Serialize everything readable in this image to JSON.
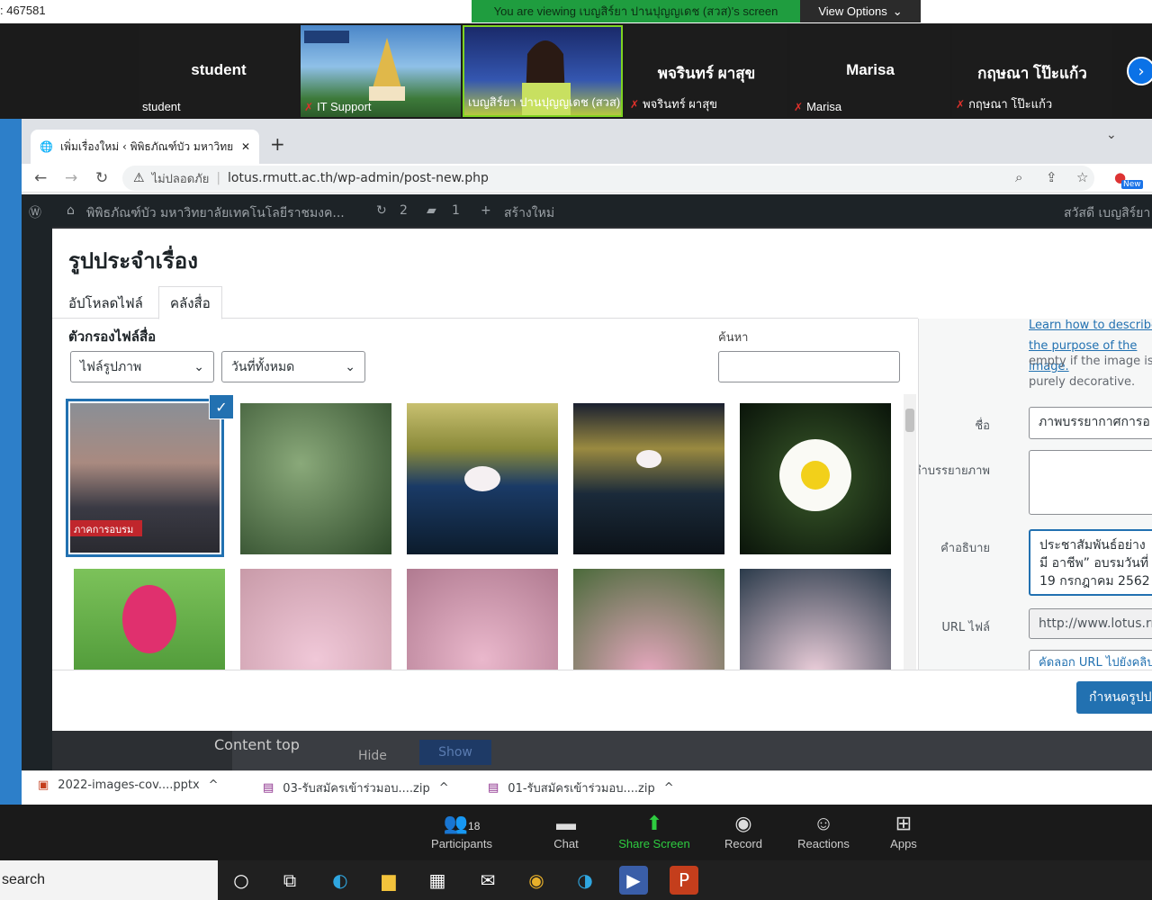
{
  "zoom": {
    "meeting_id": ": 467581",
    "viewing_banner": "You are viewing เบญสิร์ยา ปานปุญญเดช (สวส)'s screen",
    "view_options": "View Options",
    "participants": [
      {
        "name": "student",
        "label": "student",
        "muted": false
      },
      {
        "name": "",
        "label": "IT Support",
        "muted": true
      },
      {
        "name": "",
        "label": "เบญสิร์ยา ปานปุญญเดช (สวส)",
        "muted": false
      },
      {
        "name": "พจรินทร์ ผาสุข",
        "label": "พจรินทร์ ผาสุข",
        "muted": true
      },
      {
        "name": "Marisa",
        "label": "Marisa",
        "muted": true
      },
      {
        "name": "กฤษณา โป๊ะแก้ว",
        "label": "กฤษณา โป๊ะแก้ว",
        "muted": true
      }
    ],
    "toolbar": {
      "participants_count": "18",
      "participants": "Participants",
      "chat": "Chat",
      "share_screen": "Share Screen",
      "record": "Record",
      "reactions": "Reactions",
      "apps": "Apps"
    }
  },
  "browser": {
    "tab_title": "เพิ่มเรื่องใหม่ ‹ พิพิธภัณฑ์บัว มหาวิทยา",
    "insecure_label": "ไม่ปลอดภัย",
    "url": "lotus.rmutt.ac.th/wp-admin/post-new.php",
    "profile_badge": "New"
  },
  "wp_admin_bar": {
    "site": "พิพิธภัณฑ์บัว มหาวิทยาลัยเทคโนโลยีราชมงค...",
    "updates": "2",
    "comments": "1",
    "new": "สร้างใหม่",
    "greeting": "สวัสดี เบญสิร์ยา"
  },
  "modal": {
    "title": "รูปประจำเรื่อง",
    "tabs": [
      "อัปโหลดไฟล์",
      "คลังสื่อ"
    ],
    "filter_label": "ตัวกรองไฟล์สื่อ",
    "filter_type": "ไฟล์รูปภาพ",
    "filter_date": "วันที่ทั้งหมด",
    "search_label": "ค้นหา",
    "selected_caption": "ภาคการอบรม",
    "details": {
      "learn_link": "Learn how to describe the purpose of the image.",
      "learn_rest": "empty if the image is purely decorative.",
      "title_label": "ชื่อ",
      "title_value": "ภาพบรรยากาศการอ",
      "caption_label": "คำบรรยายภาพ",
      "caption_value": "",
      "desc_label": "คำอธิบาย",
      "desc_value": "ประชาสัมพันธ์อย่างมี อาชีพ” อบรมวันที่ 19 กรกฎาคม 2562",
      "url_label": "URL ไฟล์",
      "url_value": "http://www.lotus.rm",
      "copy_url": "คัดลอก URL ไปยังคลิปบ"
    },
    "set_button": "กำหนดรูปประจำเรื่อง"
  },
  "page_behind": {
    "content_top": "Content top",
    "hide": "Hide",
    "show": "Show"
  },
  "downloads": [
    "2022-images-cov....pptx",
    "03-รับสมัครเข้าร่วมอบ....zip",
    "01-รับสมัครเข้าร่วมอบ....zip"
  ],
  "taskbar": {
    "search": "search"
  }
}
